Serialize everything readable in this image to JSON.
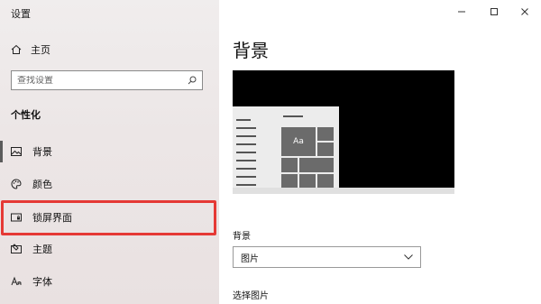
{
  "window": {
    "title": "设置"
  },
  "sidebar": {
    "home_label": "主页",
    "search_placeholder": "查找设置",
    "section_label": "个性化",
    "items": [
      {
        "label": "背景",
        "icon": "image-icon",
        "active": true
      },
      {
        "label": "颜色",
        "icon": "palette-icon"
      },
      {
        "label": "锁屏界面",
        "icon": "lock-screen-icon"
      },
      {
        "label": "主题",
        "icon": "theme-icon"
      },
      {
        "label": "字体",
        "icon": "font-icon"
      }
    ]
  },
  "main": {
    "title": "背景",
    "preview": {
      "tile_label": "Aa"
    },
    "background_label": "背景",
    "background_value": "图片",
    "choose_picture_label": "选择图片"
  },
  "colors": {
    "accent_highlight": "#e53935"
  }
}
